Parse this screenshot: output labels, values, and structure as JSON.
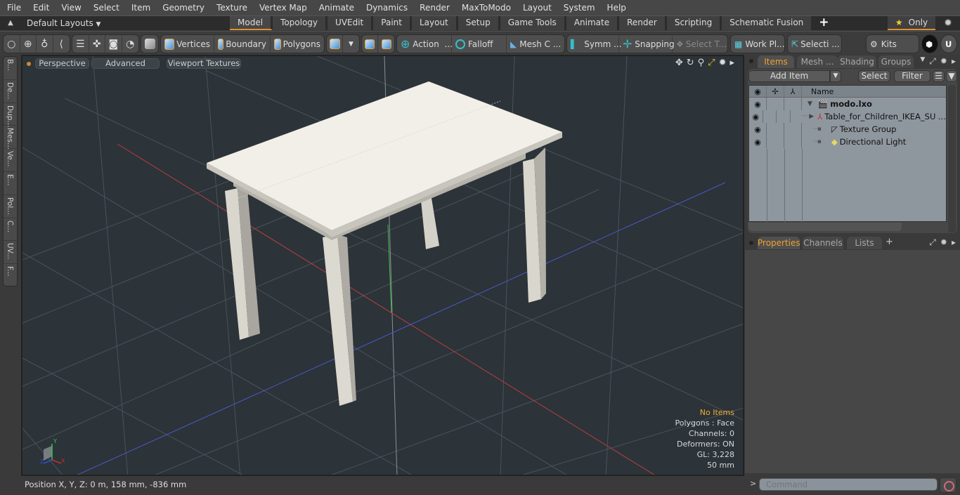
{
  "menubar": {
    "items": [
      "File",
      "Edit",
      "View",
      "Select",
      "Item",
      "Geometry",
      "Texture",
      "Vertex Map",
      "Animate",
      "Dynamics",
      "Render",
      "MaxToModo",
      "Layout",
      "System",
      "Help"
    ]
  },
  "layoutbar": {
    "layouts_label": "Default Layouts",
    "tabs": [
      "Model",
      "Topology",
      "UVEdit",
      "Paint",
      "Layout",
      "Setup",
      "Game Tools",
      "Animate",
      "Render",
      "Scripting",
      "Schematic Fusion"
    ],
    "active_tab": "Model",
    "add_tab": "+",
    "only_label": "Only"
  },
  "toolbar": {
    "select_modes": [
      "Vertices",
      "Boundary",
      "Polygons"
    ],
    "action_label": "Action",
    "action_more": "...",
    "falloff_label": "Falloff",
    "mesh_label": "Mesh C ...",
    "symm_label": "Symm ...",
    "snapping_label": "Snapping",
    "select_t_label": "Select T...",
    "workplane_label": "Work Pl...",
    "selection_label": "Selecti ...",
    "kits_label": "Kits"
  },
  "left_tabs": [
    "B...",
    "De...",
    "Dup...",
    "Mes...",
    "Ve...",
    "E...",
    "Pol...",
    "C...",
    "UV...",
    "F..."
  ],
  "viewport": {
    "dot_color": "#d08a2c",
    "view_label": "Perspective",
    "shading_label": "Advanced",
    "texture_label": "Viewport Textures",
    "hud": {
      "selection": "No Items",
      "polygons": "Polygons : Face",
      "channels": "Channels: 0",
      "deformers": "Deformers: ON",
      "gl": "GL: 3,228",
      "grid": "50 mm"
    },
    "axis_labels": {
      "x": "X",
      "y": "Y",
      "z": "Z"
    }
  },
  "statusbar": {
    "position": "Position X, Y, Z:   0 m, 158 mm, -836 mm"
  },
  "items_panel": {
    "tabs": [
      "Items",
      "Mesh ...",
      "Shading",
      "Groups"
    ],
    "active_tab": "Items",
    "add_item_label": "Add Item",
    "select_label": "Select",
    "filter_label": "Filter",
    "name_header": "Name",
    "tree": [
      {
        "name": "modo.lxo",
        "bold": true,
        "icon": "scene-clapper-icon"
      },
      {
        "name": "Table_for_Children_IKEA_SU ...",
        "icon": "mesh-locator-icon"
      },
      {
        "name": "Texture Group",
        "icon": "texture-group-icon"
      },
      {
        "name": "Directional Light",
        "icon": "light-icon"
      }
    ]
  },
  "properties_panel": {
    "tabs": [
      "Properties",
      "Channels",
      "Lists"
    ],
    "active_tab": "Properties",
    "add_tab": "+"
  },
  "command": {
    "prompt": ">",
    "placeholder": "Command"
  },
  "colors": {
    "accent": "#e0902c",
    "active_tab_text": "#f0a030",
    "viewport_bg": "#2c3339"
  }
}
